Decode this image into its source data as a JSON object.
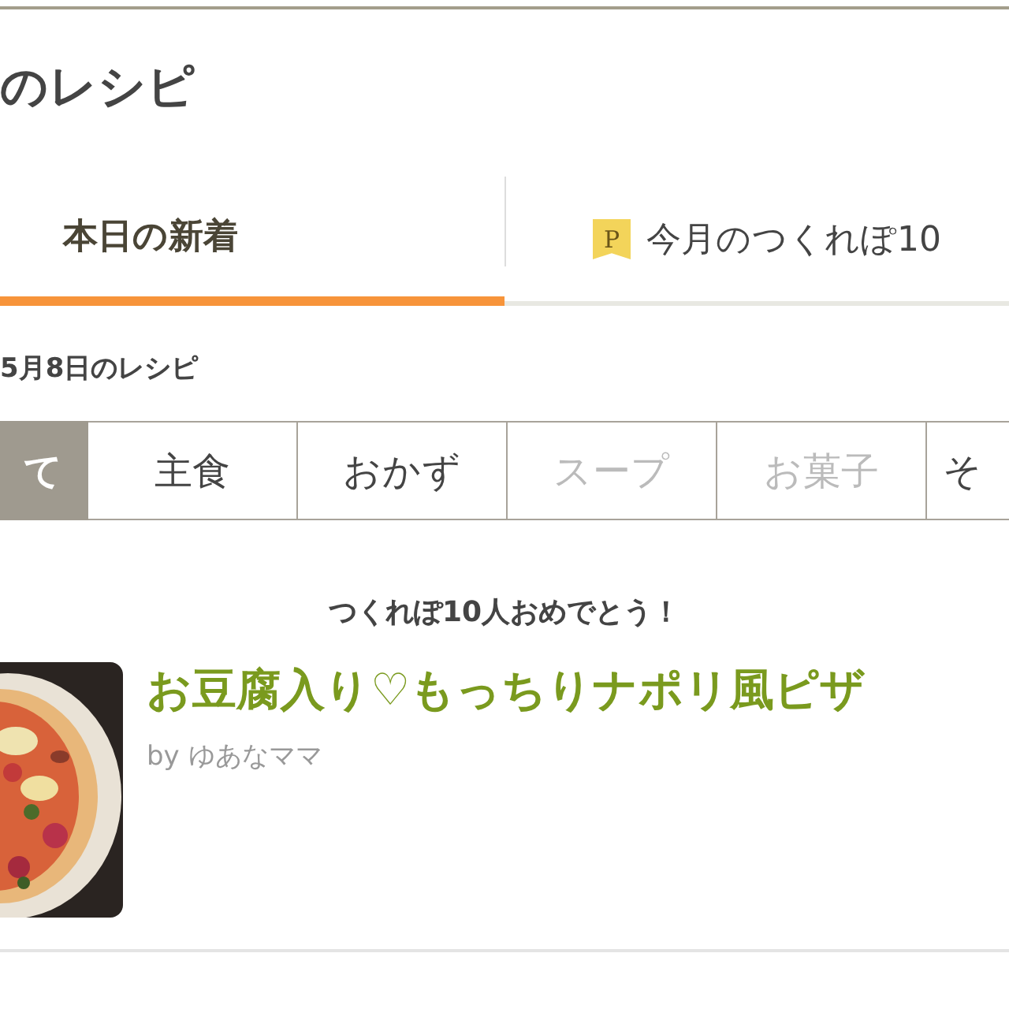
{
  "page_title": "のレシピ",
  "tabs": [
    {
      "label": "本日の新着",
      "selected": true
    },
    {
      "label": "今月のつくれぽ10",
      "badge": "P",
      "selected": false
    }
  ],
  "date_heading": "5月8日のレシピ",
  "categories": [
    {
      "label": "て",
      "selected": true,
      "disabled": false
    },
    {
      "label": "主食",
      "selected": false,
      "disabled": false
    },
    {
      "label": "おかず",
      "selected": false,
      "disabled": false
    },
    {
      "label": "スープ",
      "selected": false,
      "disabled": true
    },
    {
      "label": "お菓子",
      "selected": false,
      "disabled": true
    },
    {
      "label": "そ",
      "selected": false,
      "disabled": false
    }
  ],
  "banner": "つくれぽ10人おめでとう！",
  "recipe": {
    "title": "お豆腐入り♡もっちりナポリ風ピザ",
    "author": "by ゆあなママ"
  }
}
